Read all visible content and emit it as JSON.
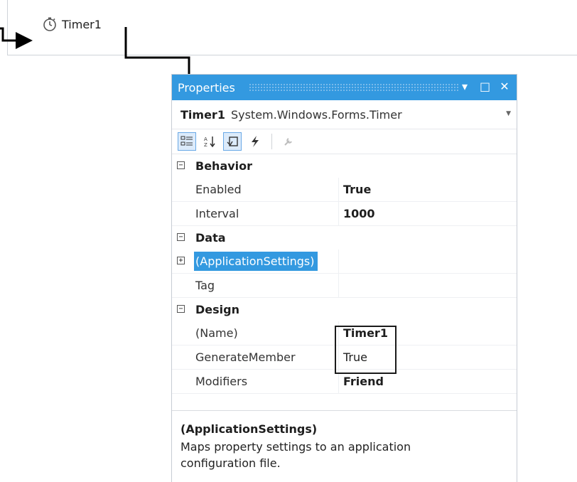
{
  "tray": {
    "component_label": "Timer1",
    "component_icon": "stopwatch-icon"
  },
  "properties": {
    "title": "Properties",
    "buttons": [
      "window-position-icon",
      "maximize-icon",
      "close-icon"
    ],
    "object_name": "Timer1",
    "object_type": "System.Windows.Forms.Timer",
    "toolbar": [
      "categorized-icon",
      "alphabetical-icon",
      "properties-icon",
      "events-icon",
      "property-pages-icon"
    ],
    "groups": [
      {
        "label": "Behavior",
        "expanded": true,
        "items": [
          {
            "name": "Enabled",
            "value": "True",
            "bold": true
          },
          {
            "name": "Interval",
            "value": "1000",
            "bold": true
          }
        ]
      },
      {
        "label": "Data",
        "expanded": true,
        "items": [
          {
            "name": "(ApplicationSettings)",
            "value": "",
            "bold": false,
            "selected": true,
            "expandable": true
          },
          {
            "name": "Tag",
            "value": "",
            "bold": false
          }
        ]
      },
      {
        "label": "Design",
        "expanded": true,
        "items": [
          {
            "name": "(Name)",
            "value": "Timer1",
            "bold": true
          },
          {
            "name": "GenerateMember",
            "value": "True",
            "bold": false
          },
          {
            "name": "Modifiers",
            "value": "Friend",
            "bold": true
          }
        ]
      }
    ],
    "description": {
      "title": "(ApplicationSettings)",
      "text": "Maps property settings to an application configuration file."
    }
  },
  "colors": {
    "accent": "#3399e0",
    "tool_active_bg": "#dcebfb"
  }
}
